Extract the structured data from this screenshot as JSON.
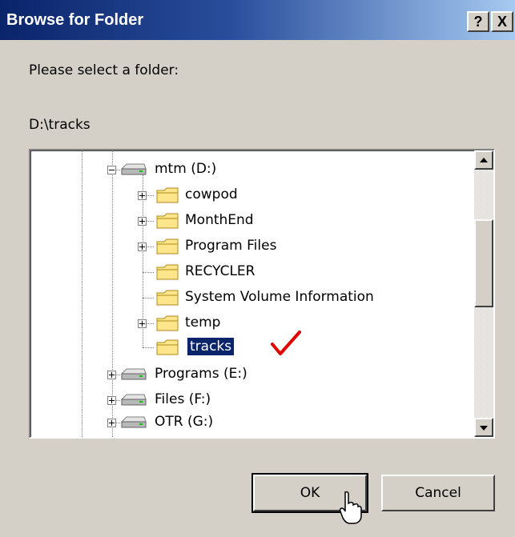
{
  "dialog": {
    "title": "Browse for Folder",
    "help_button": "?",
    "close_button": "X",
    "prompt": "Please select a folder:",
    "selected_path": "D:\\tracks"
  },
  "tree": {
    "items": [
      {
        "label": "mtm (D:)",
        "icon": "drive-icon",
        "expander": "minus"
      },
      {
        "label": "cowpod",
        "icon": "folder-icon",
        "expander": "plus"
      },
      {
        "label": "MonthEnd",
        "icon": "folder-icon",
        "expander": "plus"
      },
      {
        "label": "Program Files",
        "icon": "folder-icon",
        "expander": "plus"
      },
      {
        "label": "RECYCLER",
        "icon": "folder-icon",
        "expander": "none"
      },
      {
        "label": "System Volume Information",
        "icon": "folder-icon",
        "expander": "none"
      },
      {
        "label": "temp",
        "icon": "folder-icon",
        "expander": "plus"
      },
      {
        "label": "tracks",
        "icon": "folder-icon",
        "expander": "none",
        "selected": true
      },
      {
        "label": "Programs (E:)",
        "icon": "drive-icon",
        "expander": "plus"
      },
      {
        "label": "Files (F:)",
        "icon": "drive-icon",
        "expander": "plus"
      },
      {
        "label": "OTR (G:)",
        "icon": "drive-icon",
        "expander": "plus"
      }
    ]
  },
  "buttons": {
    "ok": "OK",
    "cancel": "Cancel"
  },
  "colors": {
    "face": "#d4d0c8",
    "title_start": "#0a246a",
    "title_end": "#a6caf0",
    "selection": "#0a246a",
    "checkmark": "#e00000"
  }
}
